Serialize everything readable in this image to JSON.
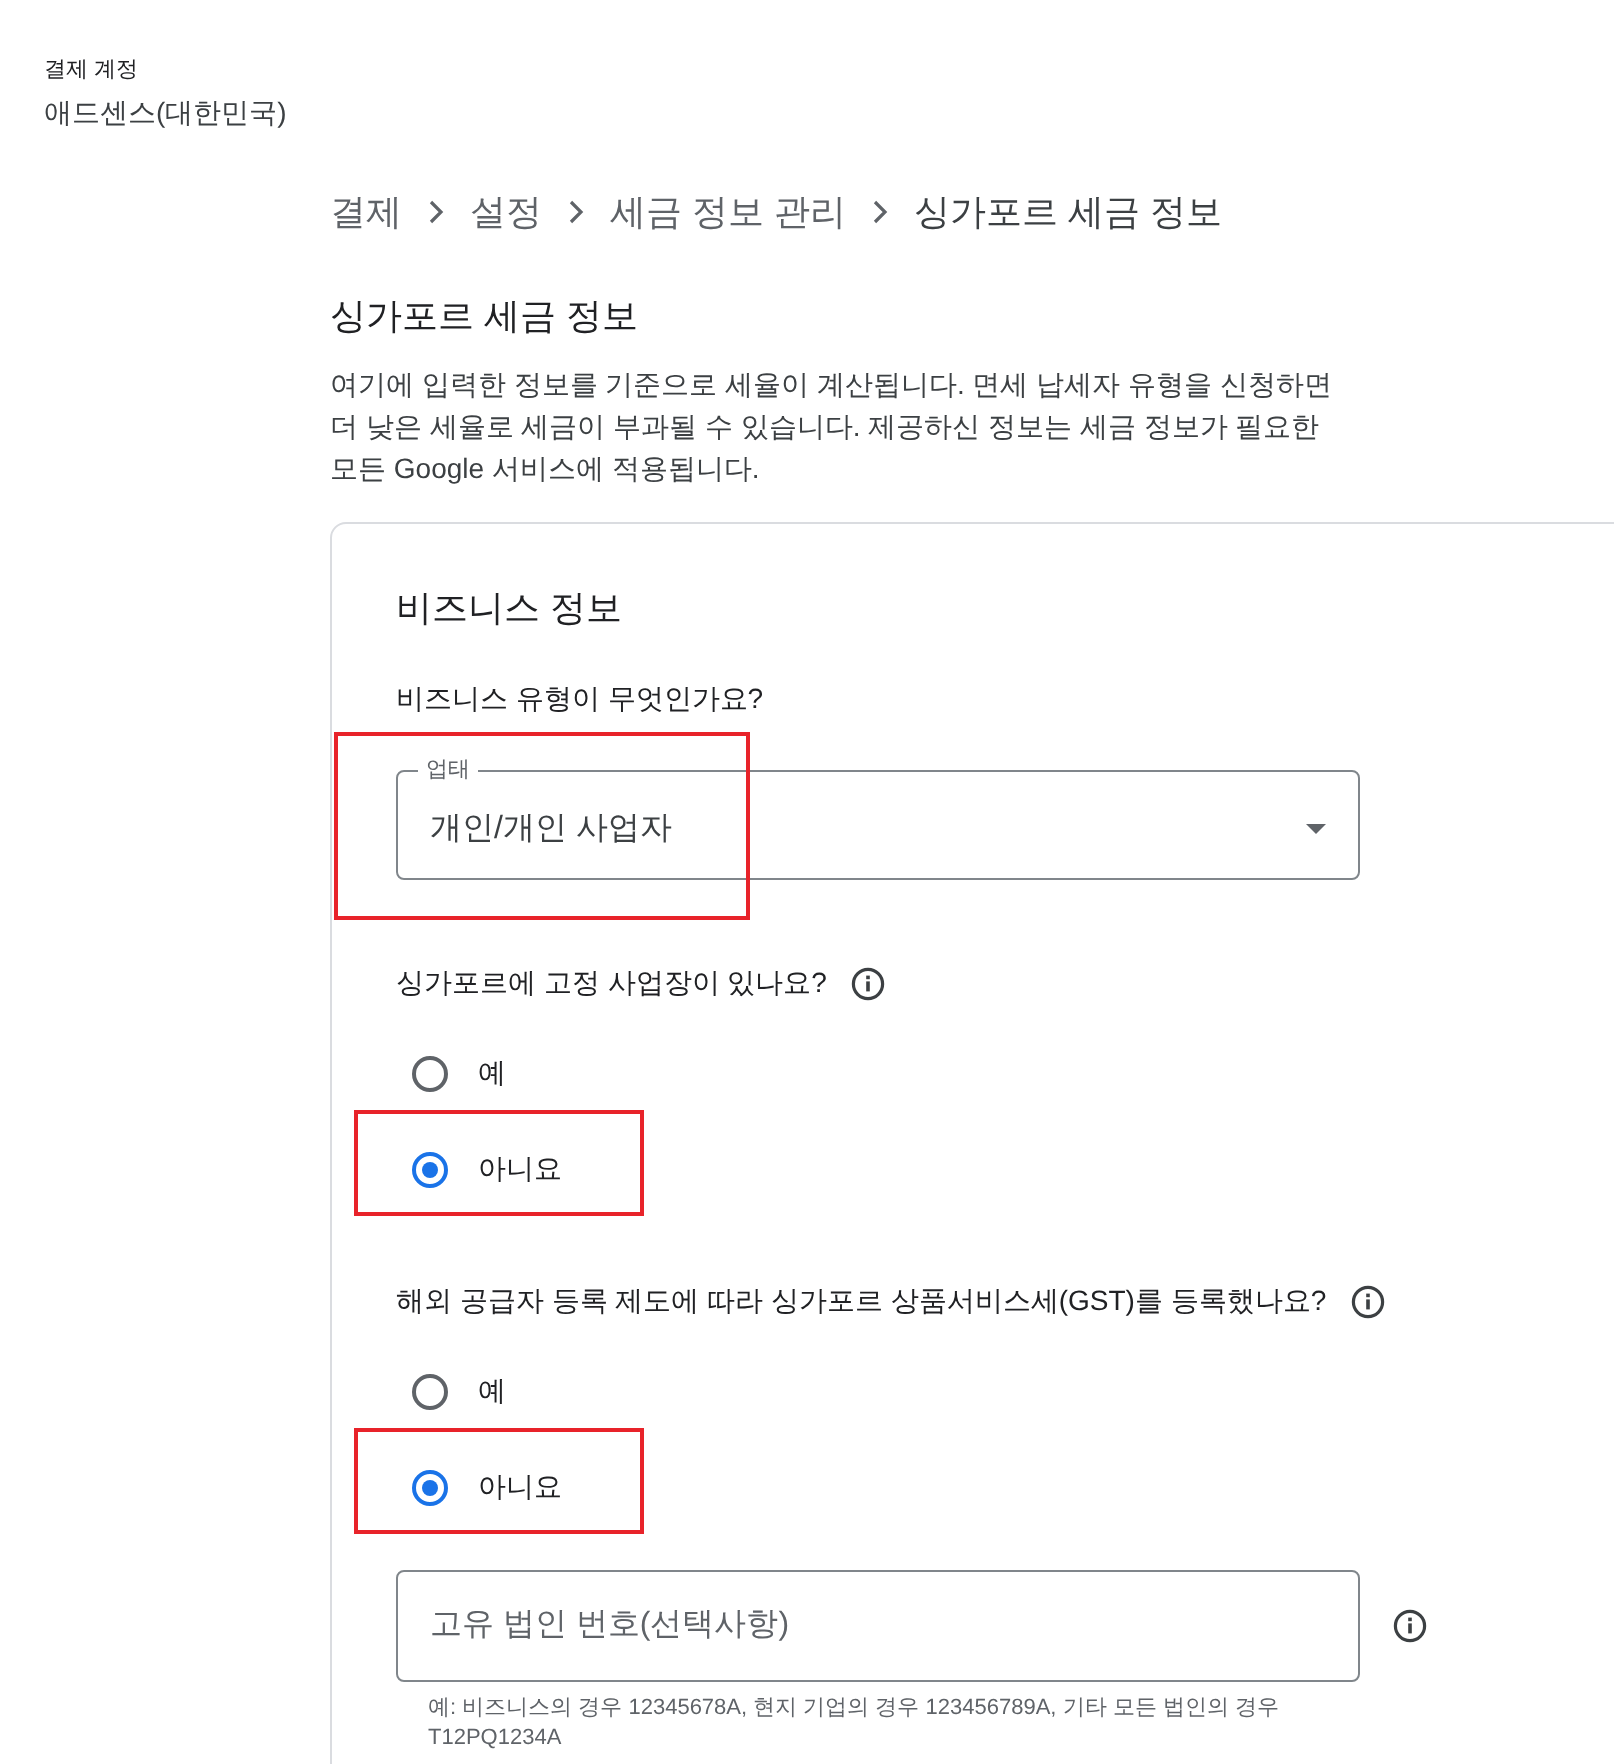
{
  "account": {
    "label": "결제 계정",
    "name": "애드센스(대한민국)"
  },
  "breadcrumb": [
    {
      "label": "결제"
    },
    {
      "label": "설정"
    },
    {
      "label": "세금 정보 관리"
    },
    {
      "label": "싱가포르 세금 정보"
    }
  ],
  "page_title": "싱가포르 세금 정보",
  "description": "여기에 입력한 정보를 기준으로 세율이 계산됩니다. 면세 납세자 유형을 신청하면 더 낮은 세율로 세금이 부과될 수 있습니다. 제공하신 정보는 세금 정보가 필요한 모든 Google 서비스에 적용됩니다.",
  "card": {
    "title": "비즈니스 정보",
    "questions": [
      {
        "kind": "select",
        "label": "비즈니스 유형이 무엇인가요?",
        "field_label": "업태",
        "value": "개인/개인 사업자",
        "highlighted": true
      },
      {
        "kind": "radio",
        "label": "싱가포르에 고정 사업장이 있나요?",
        "info": true,
        "options": [
          {
            "label": "예",
            "selected": false,
            "highlighted": false
          },
          {
            "label": "아니요",
            "selected": true,
            "highlighted": true
          }
        ]
      },
      {
        "kind": "radio",
        "label": "해외 공급자 등록 제도에 따라 싱가포르 상품서비스세(GST)를 등록했나요?",
        "info": true,
        "options": [
          {
            "label": "예",
            "selected": false,
            "highlighted": false
          },
          {
            "label": "아니요",
            "selected": true,
            "highlighted": true
          }
        ]
      },
      {
        "kind": "text",
        "placeholder": "고유 법인 번호(선택사항)",
        "info": true,
        "hint": "예: 비즈니스의 경우 12345678A, 현지 기업의 경우 123456789A, 기타 모든 법인의 경우 T12PQ1234A"
      }
    ]
  }
}
